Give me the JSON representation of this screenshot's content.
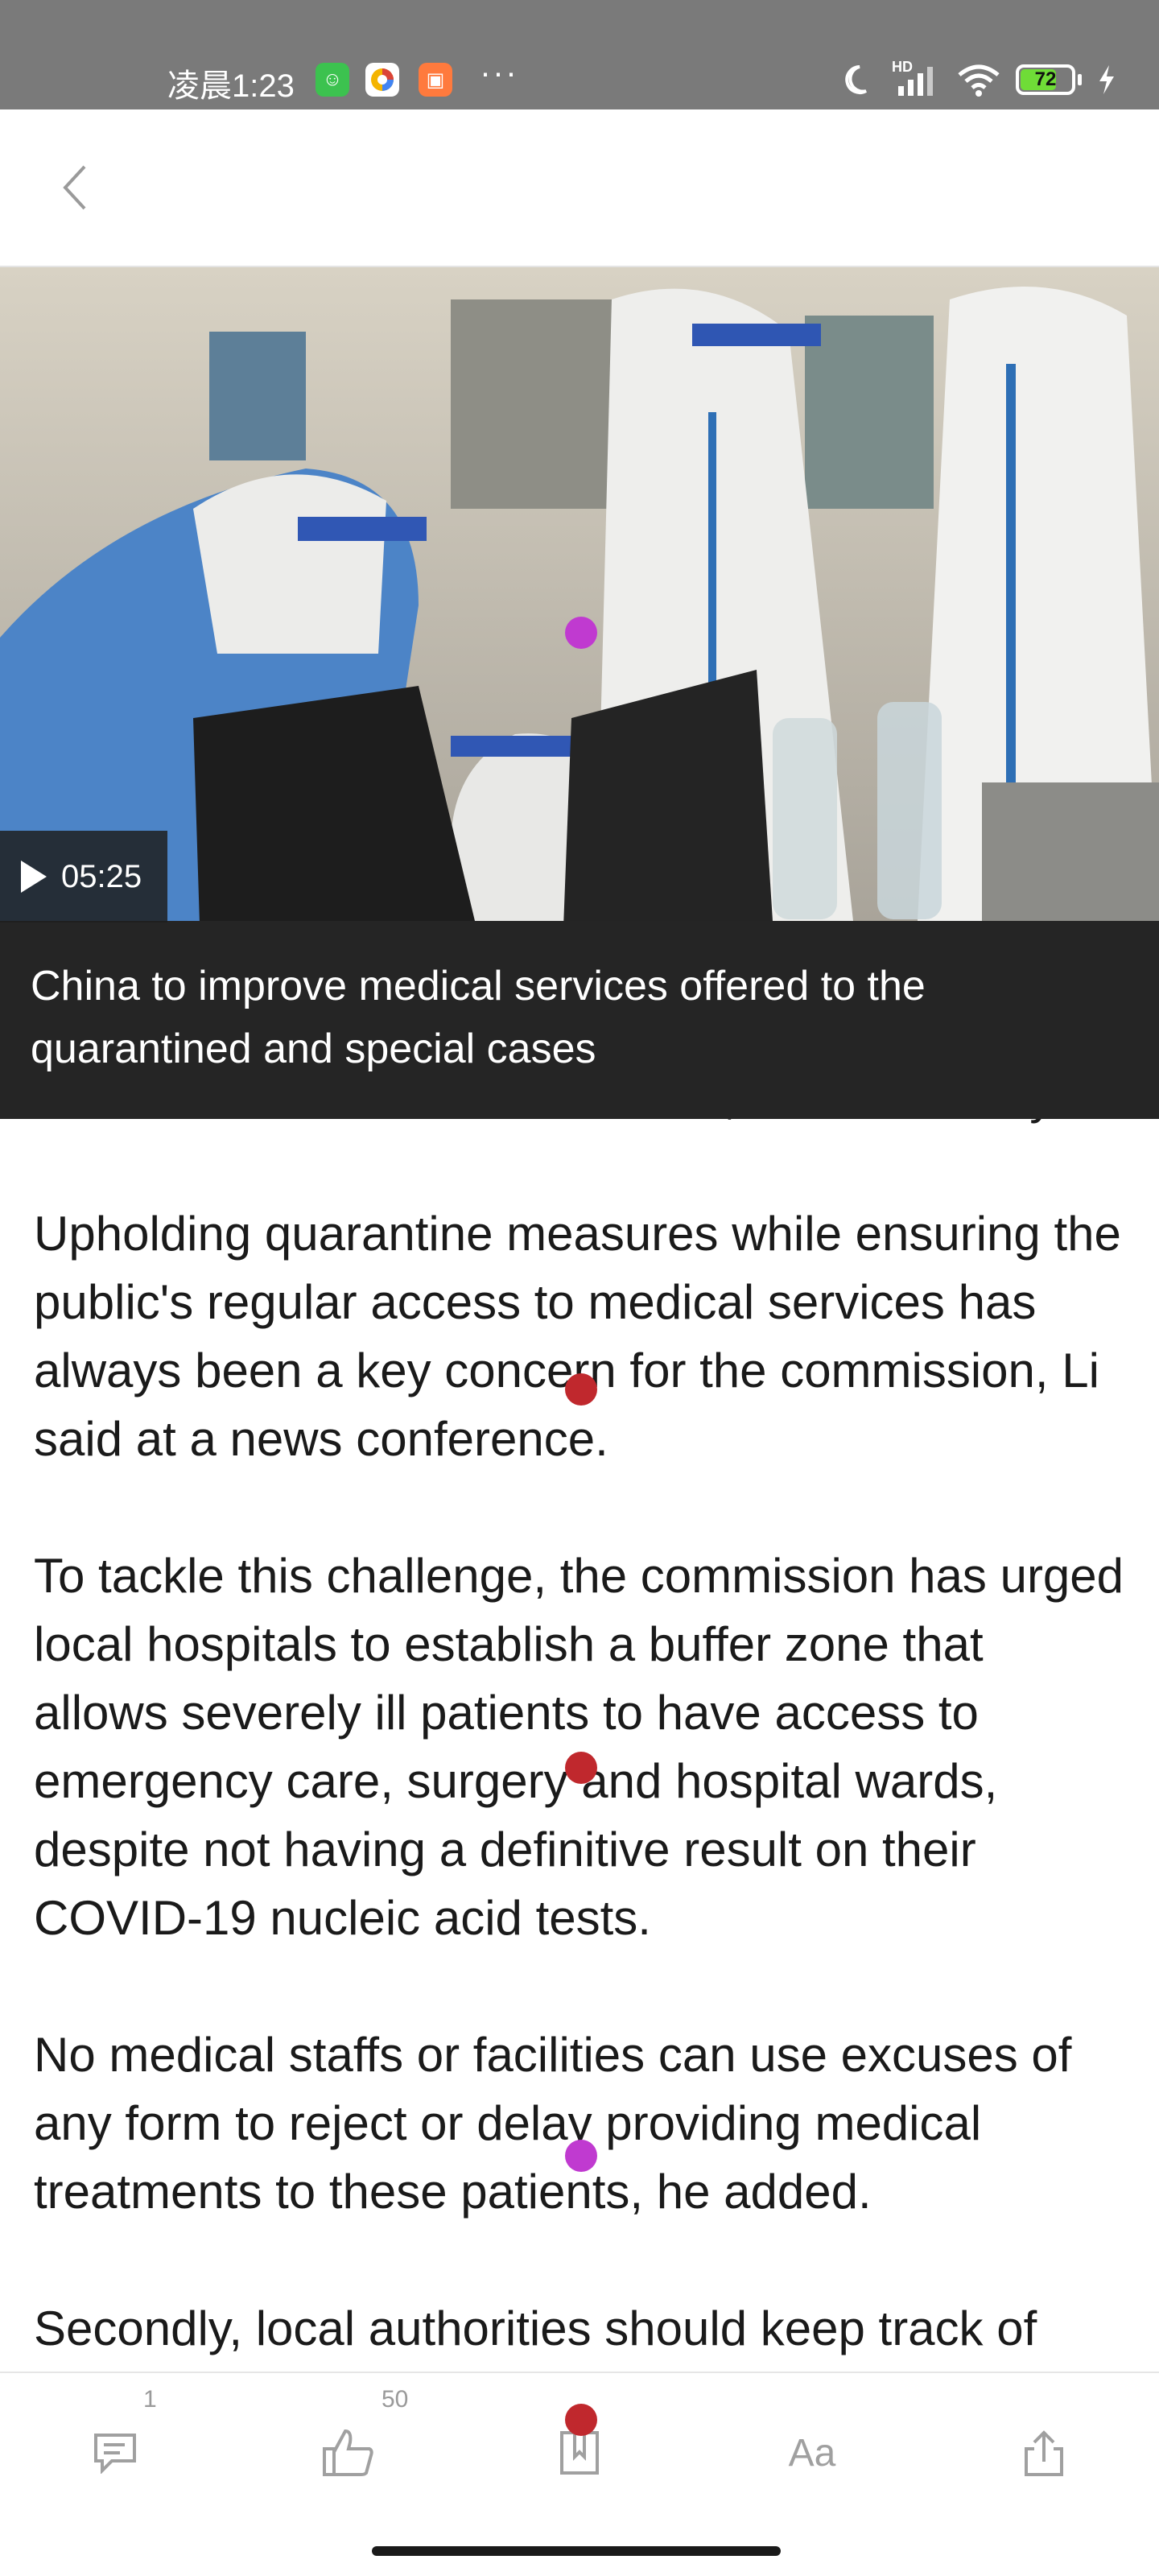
{
  "status_bar": {
    "time": "凌晨1:23",
    "more": "···",
    "network_label": "HD",
    "battery": "72"
  },
  "header": {
    "back_icon": "chevron-left-icon"
  },
  "video": {
    "duration": "05:25",
    "caption": "China to improve medical services offered to the quarantined and special cases"
  },
  "article": {
    "partial_line": "the National Health Commission, said on Friday.",
    "paragraphs": [
      "Upholding quarantine measures while ensuring the public's regular access to medical services has always been a key concern for the commission, Li said at a news conference.",
      "To tackle this challenge, the commission has urged local hospitals to establish a buffer zone that allows severely ill patients to have access to emergency care, surgery and hospital wards, despite not having a definitive result on their COVID-19 nucleic acid tests.",
      "No medical staffs or facilities can use excuses of any form to reject or delay providing medical treatments to these patients, he added.",
      "Secondly, local authorities should keep track of"
    ]
  },
  "bottom_bar": {
    "comment_count": "1",
    "like_count": "50",
    "font_label": "Aa"
  },
  "colors": {
    "status_bar_bg": "#7a7a7a",
    "caption_bg": "#252525",
    "icon_gray": "#a0a0a0",
    "marker_red": "#c0282d",
    "marker_magenta": "#c03ad0"
  }
}
